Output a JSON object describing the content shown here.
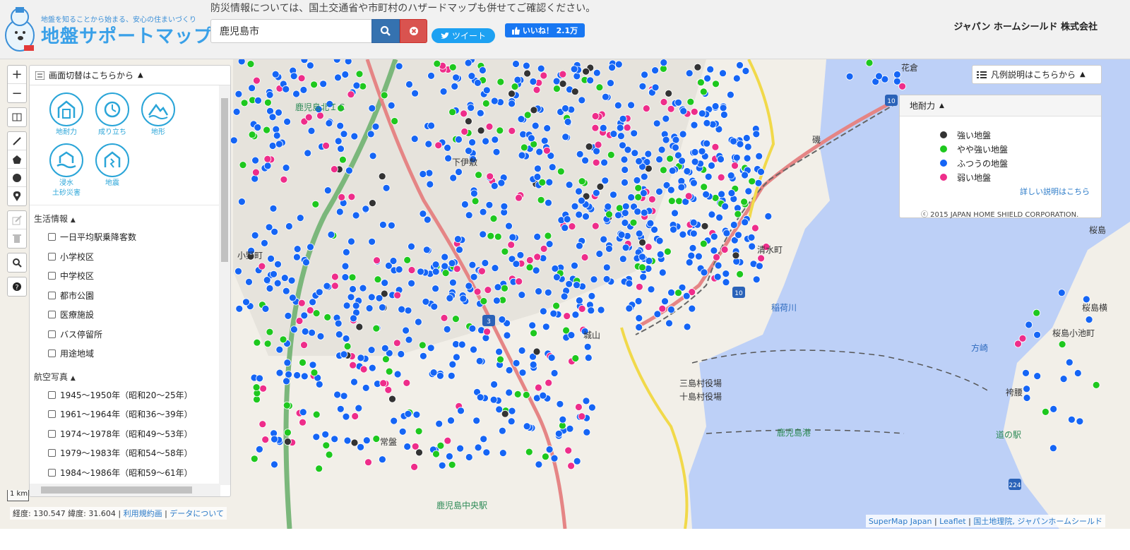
{
  "header": {
    "tagline": "地盤を知ることから始まる、安心の住まいづくり",
    "logo_title": "地盤サポートマップ",
    "notice": "防災情報については、国土交通省や市町村のハザードマップも併せてご確認ください。",
    "search_value": "鹿児島市",
    "tweet_label": "ツイート",
    "like_label": "いいね！ 2.1万",
    "company": "ジャパン ホームシールド 株式会社"
  },
  "layer_panel": {
    "title": "画面切替はこちらから",
    "icons": [
      {
        "label": "地耐力",
        "icon": "house-ground-icon"
      },
      {
        "label": "成り立ち",
        "icon": "history-clock-icon"
      },
      {
        "label": "地形",
        "icon": "terrain-wave-icon"
      },
      {
        "label": "浸水\n土砂災害",
        "icon": "flood-house-icon"
      },
      {
        "label": "地震",
        "icon": "earthquake-house-icon"
      }
    ],
    "life_section": "生活情報",
    "life_items": [
      "一日平均駅乗降客数",
      "小学校区",
      "中学校区",
      "都市公園",
      "医療施設",
      "バス停留所",
      "用途地域"
    ],
    "aerial_section": "航空写真",
    "aerial_items": [
      "1945～1950年（昭和20～25年）",
      "1961～1964年（昭和36～39年）",
      "1974～1978年（昭和49～53年）",
      "1979～1983年（昭和54～58年）",
      "1984～1986年（昭和59～61年）"
    ]
  },
  "legend": {
    "toggle_label": "凡例説明はこちらから",
    "title": "地耐力",
    "items": [
      {
        "label": "強い地盤",
        "color": "#333333"
      },
      {
        "label": "やや強い地盤",
        "color": "#1ec81e"
      },
      {
        "label": "ふつうの地盤",
        "color": "#1565f5"
      },
      {
        "label": "弱い地盤",
        "color": "#ee2d8a"
      }
    ],
    "more_link": "詳しい説明はこちら",
    "copyright": "ⓒ 2015 JAPAN HOME SHIELD CORPORATION."
  },
  "map": {
    "place_labels": [
      "鹿児島北ＩＣ",
      "下伊敷",
      "小野町",
      "清水町",
      "稲荷川",
      "城山",
      "三島村役場",
      "十島村役場",
      "鹿児島港",
      "磯",
      "花倉",
      "桜島",
      "桜島小池町",
      "方崎",
      "袴腰",
      "道の駅",
      "鹿児島中央駅",
      "常盤",
      "桜島横"
    ],
    "route_numbers": [
      "10",
      "10",
      "3",
      "224"
    ],
    "scale_label": "1 km"
  },
  "status": {
    "coords_text": "経度: 130.547 緯度: 31.604",
    "terms_link": "利用規約画",
    "data_link": "データについて"
  },
  "attribution": {
    "supermap": "SuperMap Japan",
    "leaflet": "Leaflet",
    "gsi": "国土地理院, ジャパンホームシールド"
  }
}
